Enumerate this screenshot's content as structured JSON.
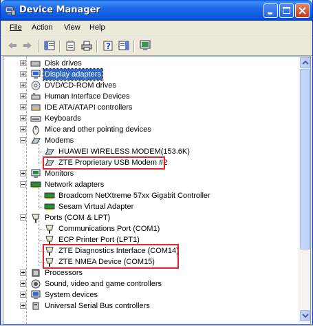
{
  "window": {
    "title": "Device Manager"
  },
  "menu": {
    "items": [
      "File",
      "Action",
      "View",
      "Help"
    ]
  },
  "toolbar": {
    "icons": [
      "back-arrow-icon",
      "forward-arrow-icon",
      "show-hide-tree-icon",
      "properties-icon",
      "print-icon",
      "help-icon",
      "show-hide-action-pane-icon",
      "scan-hardware-icon"
    ]
  },
  "tree": {
    "items": [
      {
        "label": "Disk drives",
        "expanded": false,
        "icon": "disk-drive-icon"
      },
      {
        "label": "Display adapters",
        "expanded": false,
        "icon": "display-adapter-icon",
        "selected": true
      },
      {
        "label": "DVD/CD-ROM drives",
        "expanded": false,
        "icon": "dvd-drive-icon"
      },
      {
        "label": "Human Interface Devices",
        "expanded": false,
        "icon": "hid-icon"
      },
      {
        "label": "IDE ATA/ATAPI controllers",
        "expanded": false,
        "icon": "ide-controller-icon"
      },
      {
        "label": "Keyboards",
        "expanded": false,
        "icon": "keyboard-icon"
      },
      {
        "label": "Mice and other pointing devices",
        "expanded": false,
        "icon": "mouse-icon"
      },
      {
        "label": "Modems",
        "expanded": true,
        "icon": "modem-icon",
        "children": [
          {
            "label": "HUAWEI WIRELESS MODEM(153.6K)",
            "icon": "modem-icon"
          },
          {
            "label": "ZTE Proprietary USB Modem #2",
            "icon": "modem-icon",
            "highlighted": true
          }
        ]
      },
      {
        "label": "Monitors",
        "expanded": false,
        "icon": "monitor-icon"
      },
      {
        "label": "Network adapters",
        "expanded": true,
        "icon": "network-adapter-icon",
        "children": [
          {
            "label": "Broadcom NetXtreme 57xx Gigabit Controller",
            "icon": "network-card-icon"
          },
          {
            "label": "Sesam Virtual Adapter",
            "icon": "network-card-icon"
          }
        ]
      },
      {
        "label": "Ports (COM & LPT)",
        "expanded": true,
        "icon": "port-icon",
        "children": [
          {
            "label": "Communications Port (COM1)",
            "icon": "port-icon"
          },
          {
            "label": "ECP Printer Port (LPT1)",
            "icon": "port-icon"
          },
          {
            "label": "ZTE Diagnostics Interface (COM14)",
            "icon": "port-icon",
            "highlighted": true
          },
          {
            "label": "ZTE NMEA Device (COM15)",
            "icon": "port-icon",
            "highlighted": true
          }
        ]
      },
      {
        "label": "Processors",
        "expanded": false,
        "icon": "processor-icon"
      },
      {
        "label": "Sound, video and game controllers",
        "expanded": false,
        "icon": "sound-icon"
      },
      {
        "label": "System devices",
        "expanded": false,
        "icon": "system-device-icon"
      },
      {
        "label": "Universal Serial Bus controllers",
        "expanded": false,
        "icon": "usb-icon"
      }
    ]
  }
}
